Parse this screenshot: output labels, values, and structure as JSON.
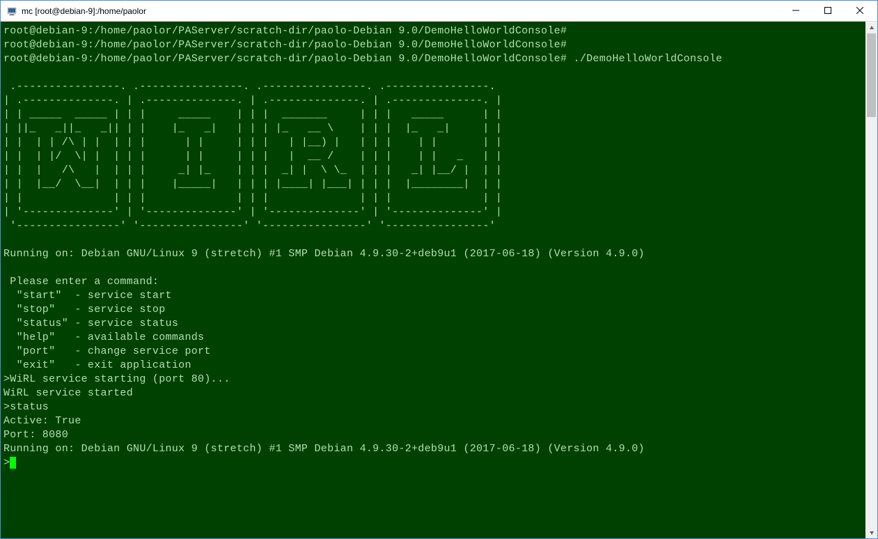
{
  "window": {
    "title": "mc [root@debian-9]:/home/paolor"
  },
  "terminal": {
    "prompt_lines": [
      "root@debian-9:/home/paolor/PAServer/scratch-dir/paolo-Debian 9.0/DemoHelloWorldConsole#",
      "root@debian-9:/home/paolor/PAServer/scratch-dir/paolo-Debian 9.0/DemoHelloWorldConsole#",
      "root@debian-9:/home/paolor/PAServer/scratch-dir/paolo-Debian 9.0/DemoHelloWorldConsole# ./DemoHelloWorldConsole"
    ],
    "ascii_art": [
      " .----------------. .----------------. .----------------. .----------------.",
      "| .--------------. | .--------------. | .--------------. | .--------------. |",
      "| | _____  _____ | | |     _____    | | |  _______     | | |   _____      | |",
      "| ||_   _||_   _|| | |    |_   _|   | | | |_   __ \\    | | |  |_   _|     | |",
      "| |  | | /\\ | |  | | |      | |     | | |   | |__) |   | | |    | |       | |",
      "| |  | |/  \\| |  | | |      | |     | | |   |  __ /    | | |    | |   _   | |",
      "| |  |   /\\   |  | | |     _| |_    | | |  _| |  \\ \\_  | | |   _| |__/ |  | |",
      "| |  |__/  \\__|  | | |    |_____|   | | | |____| |___| | | |  |________|  | |",
      "| |              | | |              | | |              | | |              | |",
      "| '--------------' | '--------------' | '--------------' | '--------------' |",
      " '----------------' '----------------' '----------------' '----------------'"
    ],
    "running_on_1": "Running on: Debian GNU/Linux 9 (stretch) #1 SMP Debian 4.9.30-2+deb9u1 (2017-06-18) (Version 4.9.0)",
    "menu": [
      " Please enter a command:",
      "  \"start\"  - service start",
      "  \"stop\"   - service stop",
      "  \"status\" - service status",
      "  \"help\"   - available commands",
      "  \"port\"   - change service port",
      "  \"exit\"   - exit application"
    ],
    "session": [
      ">WiRL service starting (port 80)...",
      "WiRL service started",
      ">status",
      "Active: True",
      "Port: 8080",
      "Running on: Debian GNU/Linux 9 (stretch) #1 SMP Debian 4.9.30-2+deb9u1 (2017-06-18) (Version 4.9.0)"
    ],
    "prompt_char": ">"
  }
}
